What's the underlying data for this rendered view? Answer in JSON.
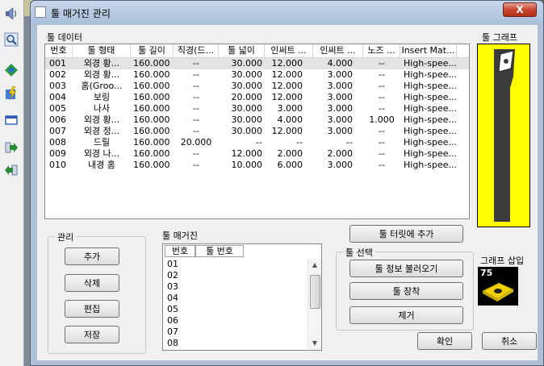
{
  "window": {
    "title": "툴 매거진 관리",
    "close_label": "X"
  },
  "tool_data": {
    "label": "툴 데이터",
    "columns": [
      "번호",
      "툴 형태",
      "툴 길이",
      "직경(드...",
      "툴 넓이",
      "인써트 ...",
      "인써트 ...",
      "노즈 ...",
      "Insert Mat..."
    ],
    "rows": [
      [
        "001",
        "외경 황...",
        "160.000",
        "--",
        "30.000",
        "12.000",
        "4.000",
        "--",
        "High-spee..."
      ],
      [
        "002",
        "외경 황...",
        "160.000",
        "--",
        "30.000",
        "12.000",
        "3.000",
        "--",
        "High-spee..."
      ],
      [
        "003",
        "홈(Groo...",
        "160.000",
        "--",
        "30.000",
        "12.000",
        "3.000",
        "--",
        "High-spee..."
      ],
      [
        "004",
        "보링",
        "160.000",
        "--",
        "20.000",
        "12.000",
        "3.000",
        "--",
        "High-spee..."
      ],
      [
        "005",
        "나사",
        "160.000",
        "--",
        "30.000",
        "3.000",
        "3.000",
        "--",
        "High-spee..."
      ],
      [
        "006",
        "외경 황...",
        "160.000",
        "--",
        "30.000",
        "4.000",
        "3.000",
        "1.000",
        "High-spee..."
      ],
      [
        "007",
        "외경 정...",
        "160.000",
        "--",
        "30.000",
        "12.000",
        "3.000",
        "--",
        "High-spee..."
      ],
      [
        "008",
        "드릴",
        "160.000",
        "20.000",
        "--",
        "--",
        "--",
        "--",
        "High-spee..."
      ],
      [
        "009",
        "외경 나...",
        "160.000",
        "--",
        "12.000",
        "2.000",
        "2.000",
        "--",
        "High-spee..."
      ],
      [
        "010",
        "내경 홈",
        "160.000",
        "--",
        "10.000",
        "6.000",
        "3.000",
        "--",
        "High-spee..."
      ]
    ]
  },
  "tool_graph": {
    "label": "툴 그래프"
  },
  "management": {
    "label": "관리",
    "add": "추가",
    "delete": "삭제",
    "edit": "편집",
    "save": "저장"
  },
  "magazine": {
    "label": "툴 매거진",
    "columns": [
      "번호",
      "툴 번호"
    ],
    "rows": [
      "01",
      "02",
      "03",
      "04",
      "05",
      "06",
      "07",
      "08"
    ]
  },
  "turret_add": "툴 터릿에 추가",
  "tool_select": {
    "label": "툴 선택",
    "load_info": "툴 정보 불러오기",
    "mount": "툴 장착",
    "remove": "제거"
  },
  "insert_graph": {
    "label": "그래프 삽입",
    "value": "75"
  },
  "ok": "확인",
  "cancel": "취소",
  "colors": {
    "graph_bg": "#ffff00",
    "title_bar": "#aac0dc",
    "close": "#c8452f"
  },
  "host_toolbar_icons": [
    "speaker-icon",
    "zoom-icon",
    "refresh-green-icon",
    "lightning-icon",
    "window-icon",
    "arrow-right-icon",
    "arrow-left-icon"
  ]
}
